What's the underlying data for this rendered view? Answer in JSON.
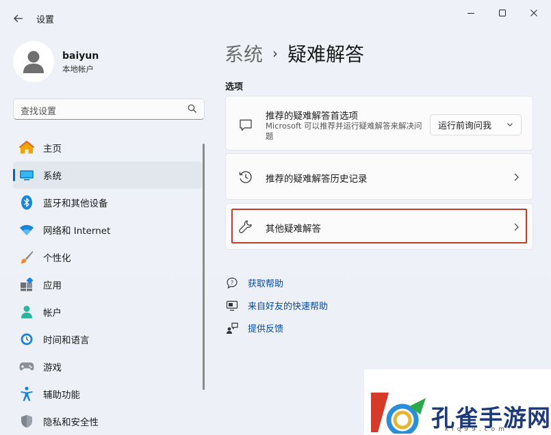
{
  "window": {
    "app_title": "设置",
    "controls": {
      "minimize": "minimize-icon",
      "maximize": "maximize-icon",
      "close": "close-icon"
    }
  },
  "user": {
    "name": "baiyun",
    "account_type": "本地帐户"
  },
  "search": {
    "placeholder": "查找设置"
  },
  "sidebar": {
    "items": [
      {
        "label": "主页",
        "icon": "home-icon"
      },
      {
        "label": "系统",
        "icon": "system-icon",
        "active": true
      },
      {
        "label": "蓝牙和其他设备",
        "icon": "bluetooth-icon"
      },
      {
        "label": "网络和 Internet",
        "icon": "wifi-icon"
      },
      {
        "label": "个性化",
        "icon": "brush-icon"
      },
      {
        "label": "应用",
        "icon": "apps-icon"
      },
      {
        "label": "帐户",
        "icon": "account-icon"
      },
      {
        "label": "时间和语言",
        "icon": "clock-globe-icon"
      },
      {
        "label": "游戏",
        "icon": "gamepad-icon"
      },
      {
        "label": "辅助功能",
        "icon": "accessibility-icon"
      },
      {
        "label": "隐私和安全性",
        "icon": "shield-icon"
      }
    ]
  },
  "breadcrumb": {
    "parent": "系统",
    "separator": "›",
    "current": "疑难解答"
  },
  "options": {
    "section_label": "选项",
    "recommended": {
      "title": "推荐的疑难解答首选项",
      "description": "Microsoft 可以推荐并运行疑难解答来解决问题",
      "dropdown_value": "运行前询问我"
    },
    "history": {
      "title": "推荐的疑难解答历史记录"
    },
    "other": {
      "title": "其他疑难解答"
    }
  },
  "links": [
    {
      "label": "获取帮助",
      "icon": "help-icon"
    },
    {
      "label": "来自好友的快速帮助",
      "icon": "quick-assist-icon"
    },
    {
      "label": "提供反馈",
      "icon": "feedback-icon"
    }
  ],
  "watermark": {
    "text": "孔雀手游网",
    "sub": "klq99.com"
  },
  "colors": {
    "accent": "#0067c0",
    "link": "#0049a4",
    "highlight_border": "#c0392b"
  }
}
